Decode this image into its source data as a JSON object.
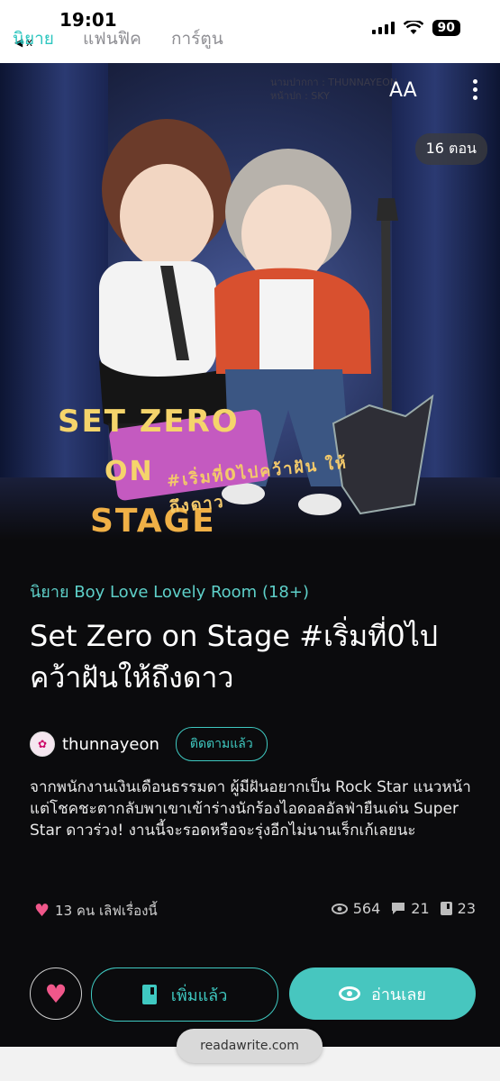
{
  "status_bar": {
    "time": "19:01",
    "battery": "90",
    "back_label": "◀ x"
  },
  "top_tabs": [
    {
      "label": "นิยาย",
      "active": true
    },
    {
      "label": "แฟนฟิค",
      "active": false
    },
    {
      "label": "การ์ตูน",
      "active": false
    }
  ],
  "cover": {
    "author_stamp_line1": "นามปากกา : THUNNAYEON",
    "author_stamp_line2": "หน้าปก : SKY",
    "text_size_label": "AA",
    "episode_badge": "16 ตอน",
    "title_art_line1": "SET ZERO",
    "title_art_line2": "ON",
    "title_art_line3": "STAGE",
    "title_art_thai": "#เริ่มที่0ไปคว้าฝัน ให้ถึงดาว"
  },
  "story": {
    "category": "นิยาย Boy Love Lovely Room (18+)",
    "title": "Set Zero on Stage #เริ่มที่0ไปคว้าฝันให้ถึงดาว",
    "author": "thunnayeon",
    "follow_label": "ติดตามแล้ว",
    "synopsis": "จากพนักงานเงินเดือนธรรมดา ผู้มีฝันอยากเป็น Rock Star แนวหน้า แต่โชคชะตากลับพาเขาเข้าร่างนักร้องไอดอลอัลฟ่ายืนเด่น Super Star ดาวร่วง! งานนี้จะรอดหรือจะรุ่งอีกไม่นานเร็กเก้เลยนะ"
  },
  "stats": {
    "likes": "13 คน เลิฟเรื่องนี้",
    "views": "564",
    "comments": "21",
    "bookmarks": "23"
  },
  "actions": {
    "add_label": "เพิ่มแล้ว",
    "read_label": "อ่านเลย"
  },
  "browser": {
    "url": "readawrite.com"
  },
  "colors": {
    "accent": "#47c6bf",
    "heart": "#f0578a",
    "background": "#0b0b0d"
  },
  "icons": [
    "heart-icon",
    "eye-icon",
    "comment-icon",
    "book-icon",
    "more-icon",
    "text-size-icon"
  ]
}
